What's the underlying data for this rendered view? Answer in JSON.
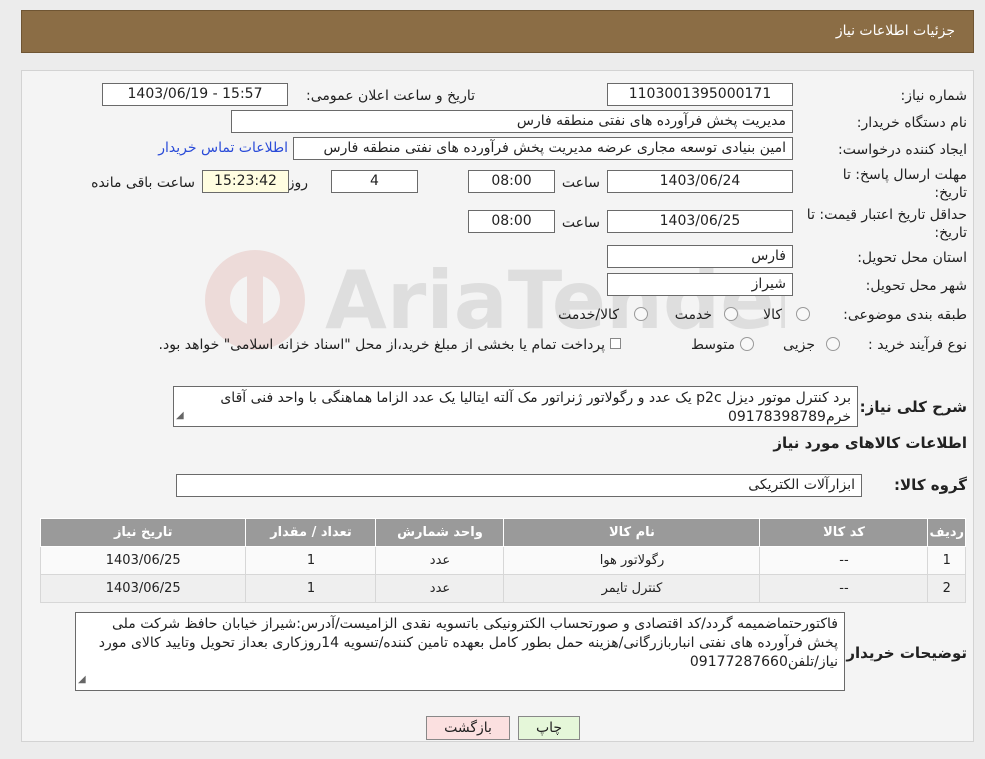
{
  "header": {
    "title": "جزئیات اطلاعات نیاز"
  },
  "fields": {
    "need_number_label": "شماره نیاز:",
    "need_number": "1103001395000171",
    "announce_label": "تاریخ و ساعت اعلان عمومی:",
    "announce_value": "1403/06/19 - 15:57",
    "buyer_org_label": "نام دستگاه خریدار:",
    "buyer_org": "مدیریت پخش فرآورده های نفتی منطقه فارس",
    "requester_label": "ایجاد کننده درخواست:",
    "requester": "امین بنیادی توسعه مجاری عرضه مدیریت پخش فرآورده های نفتی منطقه فارس",
    "contact_link": "اطلاعات تماس خریدار",
    "deadline_label_1": "مهلت ارسال پاسخ: تا",
    "deadline_label_2": "تاریخ:",
    "deadline_date": "1403/06/24",
    "time_label": "ساعت",
    "deadline_time": "08:00",
    "days_value": "4",
    "days_label": "روز و",
    "remaining_time": "15:23:42",
    "remaining_label": "ساعت باقی مانده",
    "validity_label_1": "حداقل تاریخ اعتبار قیمت: تا",
    "validity_label_2": "تاریخ:",
    "validity_date": "1403/06/25",
    "validity_time": "08:00",
    "province_label": "استان محل تحویل:",
    "province": "فارس",
    "city_label": "شهر محل تحویل:",
    "city": "شیراز",
    "category_label": "طبقه بندی موضوعی:",
    "category_options": [
      "کالا",
      "خدمت",
      "کالا/خدمت"
    ],
    "process_label": "نوع فرآیند خرید :",
    "process_options": [
      "جزیی",
      "متوسط"
    ],
    "process_note": "پرداخت تمام یا بخشی از مبلغ خرید،از محل \"اسناد خزانه اسلامی\" خواهد بود."
  },
  "summary": {
    "label": "شرح کلی نیاز:",
    "text": "برد کنترل موتور  دیزل p2c  یک عدد و رگولاتور ژنراتور مک آلته ایتالیا یک عدد الزاما هماهنگی با واحد فنی آقای خرم09178398789"
  },
  "goods_section_title": "اطلاعات کالاهای مورد نیاز",
  "goods_group": {
    "label": "گروه کالا:",
    "value": "ابزارآلات الکتریکی"
  },
  "table": {
    "headers": [
      "ردیف",
      "کد کالا",
      "نام کالا",
      "واحد شمارش",
      "تعداد / مقدار",
      "تاریخ نیاز"
    ],
    "rows": [
      [
        "1",
        "--",
        "رگولاتور هوا",
        "عدد",
        "1",
        "1403/06/25"
      ],
      [
        "2",
        "--",
        "کنترل تایمر",
        "عدد",
        "1",
        "1403/06/25"
      ]
    ]
  },
  "buyer_notes": {
    "label": "توضیحات خریدار:",
    "text": "فاکتورحتماضمیمه گردد/کد اقتصادی و صورتحساب الکترونیکی باتسویه نقدی الزامیست/آدرس:شیراز خیابان حافظ شرکت ملی پخش فرآورده های نفتی انباربازرگانی/هزینه حمل بطور کامل بعهده تامین کننده/تسویه 14روزکاری بعداز تحویل وتایید کالای مورد نیاز/تلفن09177287660"
  },
  "buttons": {
    "print": "چاپ",
    "back": "بازگشت"
  },
  "watermark": "AriaTender.neT",
  "colors": {
    "header": "#8b6d45",
    "link": "#2a4bd8",
    "print_btn": "#e5f7d9",
    "back_btn": "#fbe0e0"
  }
}
